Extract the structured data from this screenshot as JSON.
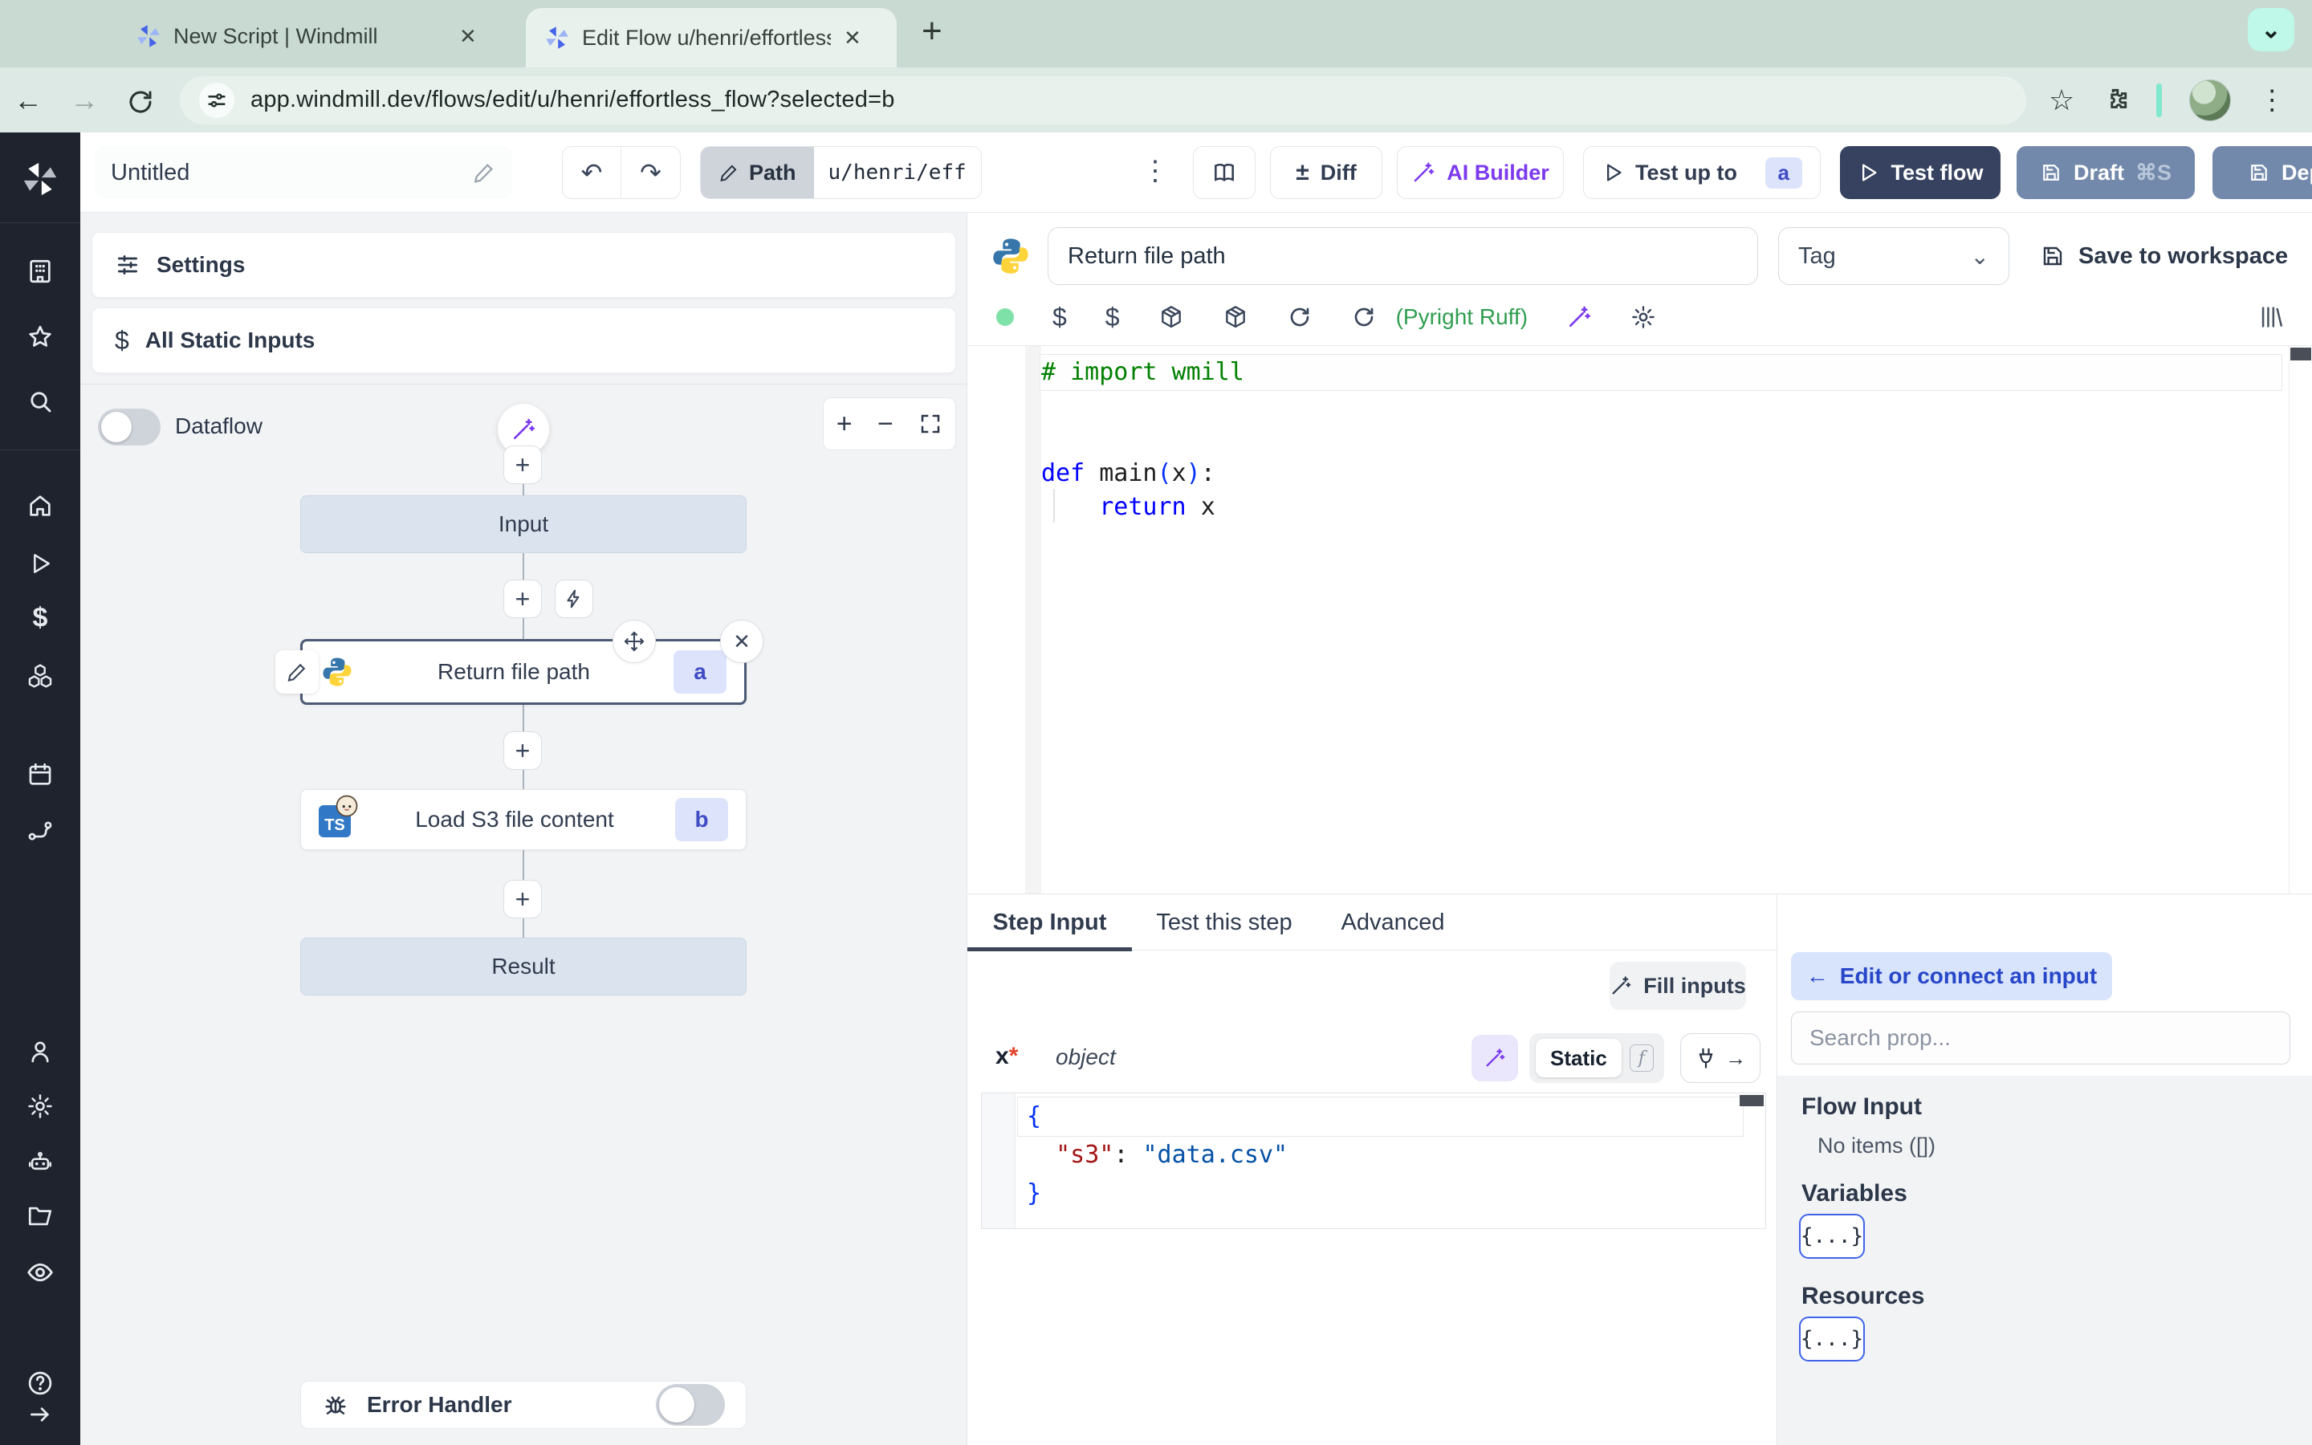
{
  "browser": {
    "tab1": "New Script | Windmill",
    "tab2": "Edit Flow u/henri/effortless_fl",
    "url": "app.windmill.dev/flows/edit/u/henri/effortless_flow?selected=b"
  },
  "glyphs": {
    "back": "←",
    "forward": "→",
    "newtab": "+",
    "close": "✕",
    "kebab": "⋮",
    "star": "☆",
    "undo": "↶",
    "redo": "↷",
    "diff_sign": "±",
    "chevron": "⌄",
    "plus": "+",
    "minus": "−",
    "dollar": "$",
    "x_close": "✕",
    "arrow_left": "←",
    "arrow_right": "→",
    "ts": "TS",
    "fn": "f"
  },
  "toolbar": {
    "flow_name": "Untitled",
    "path_label": "Path",
    "path_value": "u/henri/eff",
    "diff": "Diff",
    "ai_builder": "AI Builder",
    "test_up_to": "Test up to",
    "test_up_to_badge": "a",
    "test_flow": "Test flow",
    "draft": "Draft",
    "draft_shortcut": "⌘S",
    "deploy": "Deploy"
  },
  "flow_panel": {
    "settings": "Settings",
    "all_static_inputs": "All Static Inputs",
    "dataflow": "Dataflow",
    "input_node": "Input",
    "result_node": "Result",
    "steps": [
      {
        "id": "a",
        "label": "Return file path"
      },
      {
        "id": "b",
        "label": "Load S3 file content"
      }
    ],
    "error_handler": "Error Handler"
  },
  "editor": {
    "title": "Return file path",
    "tag": "Tag",
    "save": "Save to workspace",
    "lint": "(Pyright Ruff)",
    "code": {
      "comment": "# import wmill",
      "kw_def": "def",
      "fn": "main",
      "paren_open": "(",
      "arg": "x",
      "paren_close": ")",
      "colon": ":",
      "indent": "    ",
      "kw_return": "return",
      "ret_sp": " ",
      "ret_val": "x",
      "sp": " "
    }
  },
  "step_panel": {
    "tabs": [
      {
        "label": "Step Input"
      },
      {
        "label": "Test this step"
      },
      {
        "label": "Advanced"
      }
    ],
    "fill_inputs": "Fill inputs",
    "arg_name": "x",
    "required_star": "*",
    "arg_type": "object",
    "static_label": "Static",
    "json": {
      "open": "{",
      "indent": "  ",
      "key": "\"s3\"",
      "sep": ": ",
      "value": "\"data.csv\"",
      "close": "}"
    }
  },
  "prop_panel": {
    "edit_connect": "Edit or connect an input",
    "search_placeholder": "Search prop...",
    "flow_input_title": "Flow Input",
    "flow_input_empty": "No items ([])",
    "variables_title": "Variables",
    "resources_title": "Resources",
    "braces_button": "{...}"
  },
  "colors": {
    "accent_violet": "#7c3aed",
    "navy_button": "#36425f",
    "slate_button": "#7389ab",
    "badge_bg": "#dde3fb",
    "badge_text": "#3f4cc4",
    "lint_green": "#2f9e50"
  }
}
